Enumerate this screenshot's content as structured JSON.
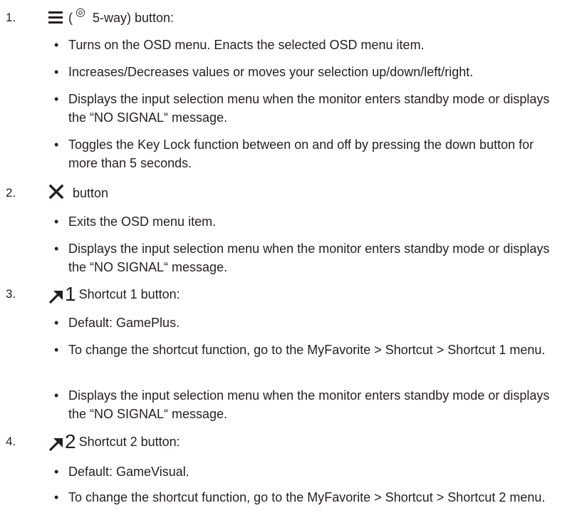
{
  "items": [
    {
      "number": "1.",
      "label_prefix": "(",
      "label": "5-way) button:",
      "icon": "menu-lines-icon",
      "sub_icon": "dial-icon",
      "sub_icon_glyph": "◎",
      "bullets": [
        "Turns on the OSD menu. Enacts the selected OSD menu item.",
        "Increases/Decreases values or moves your selection up/down/left/right.",
        "Displays the input selection menu when the monitor enters standby mode or displays the “NO SIGNAL“ message.",
        "Toggles the Key Lock function between on and off by pressing the down button for more than 5 seconds."
      ]
    },
    {
      "number": "2.",
      "label": "button",
      "icon": "close-x-icon",
      "bullets": [
        "Exits the OSD menu item.",
        "Displays the input selection menu when the monitor enters standby mode or displays the “NO SIGNAL“ message."
      ]
    },
    {
      "number": "3.",
      "label": "Shortcut 1 button:",
      "icon": "shortcut-arrow-icon",
      "icon_digit": "1",
      "bullets": [
        "Default: GamePlus.",
        "To change the shortcut function, go to the MyFavorite > Shortcut > Shortcut 1 menu.",
        "Displays the input selection menu when the monitor enters standby mode or displays the “NO SIGNAL“ message."
      ]
    },
    {
      "number": "4.",
      "label": "Shortcut 2 button:",
      "icon": "shortcut-arrow-icon",
      "icon_digit": "2",
      "bullets": [
        "Default: GameVisual.",
        "To change the shortcut function, go to the MyFavorite > Shortcut > Shortcut 2 menu."
      ]
    }
  ]
}
